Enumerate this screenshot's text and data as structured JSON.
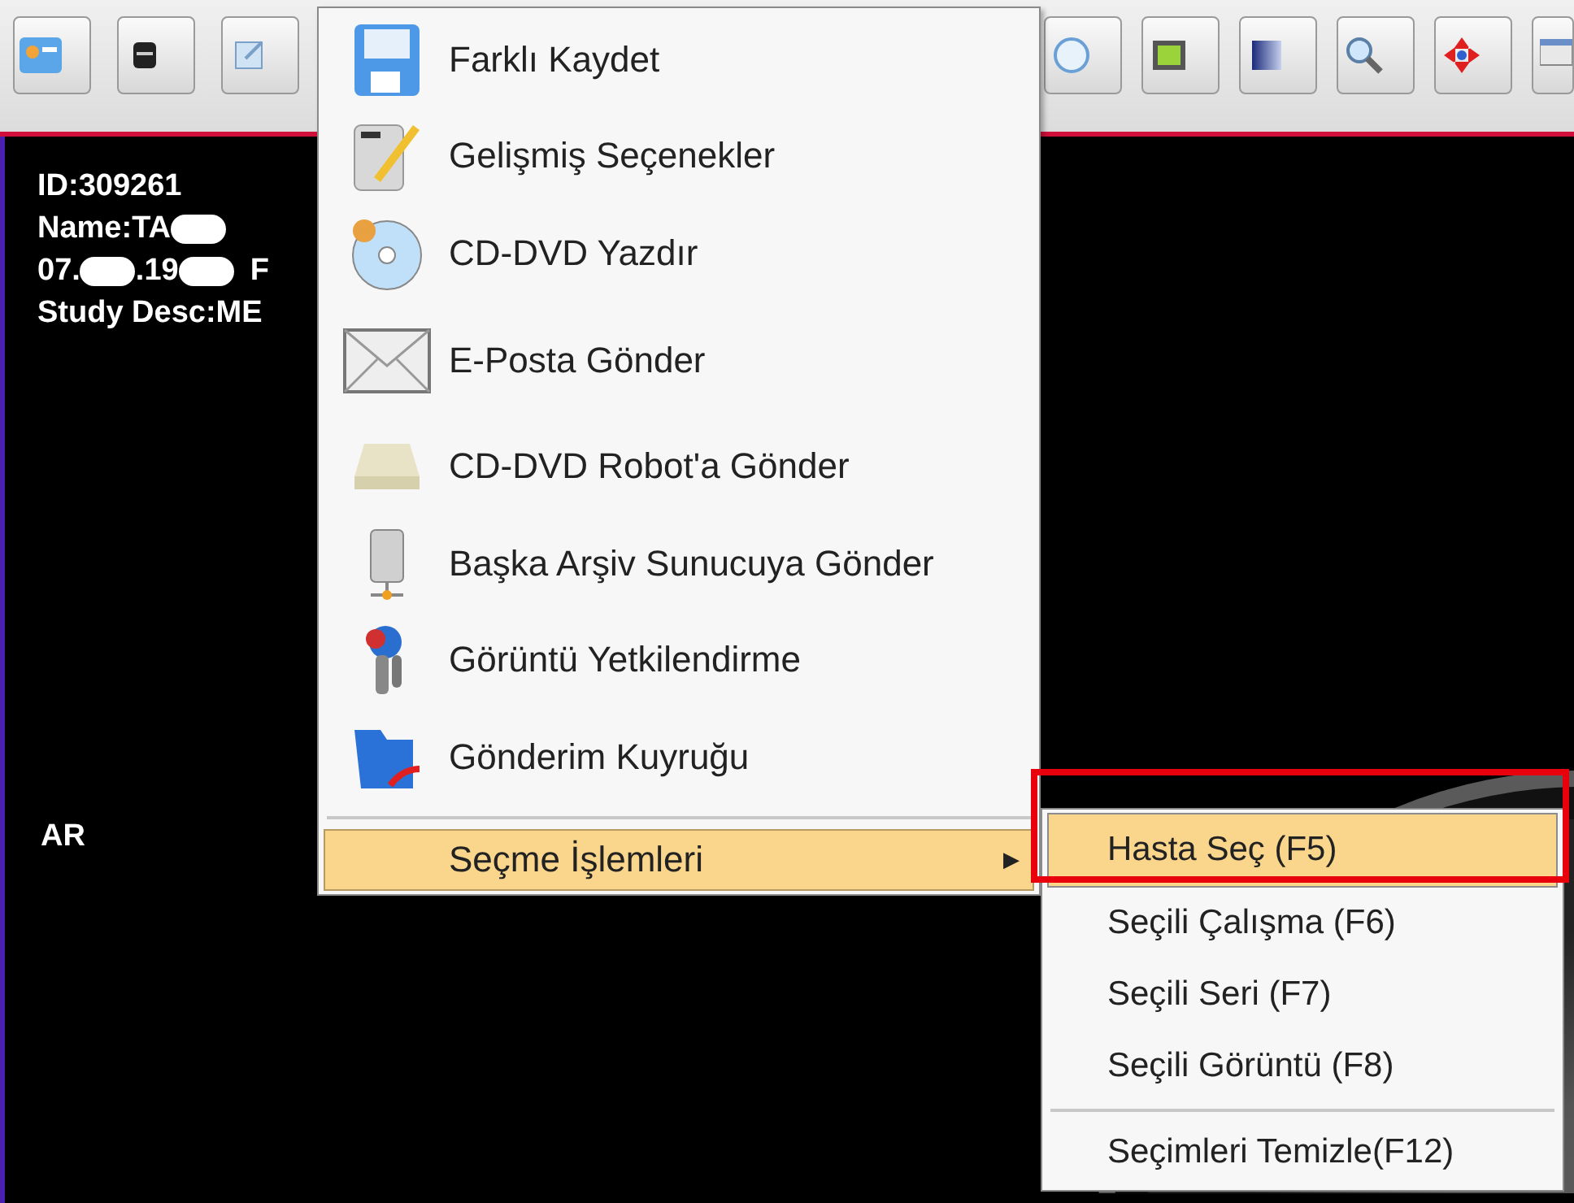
{
  "overlay": {
    "id": "ID:309261",
    "name": "Name:TA",
    "date_parts": [
      "07.",
      ".19"
    ],
    "sex": "F",
    "study": "Study Desc:ME",
    "orientation": "AR"
  },
  "menu": {
    "items": [
      {
        "kind": "floppy",
        "label": "Farklı Kaydet"
      },
      {
        "kind": "pencil",
        "label": "Gelişmiş Seçenekler"
      },
      {
        "kind": "disc",
        "label": "CD-DVD Yazdır"
      },
      {
        "kind": "envelope",
        "label": "E-Posta Gönder"
      },
      {
        "kind": "drive",
        "label": "CD-DVD Robot'a Gönder"
      },
      {
        "kind": "server",
        "label": "Başka Arşiv Sunucuya Gönder"
      },
      {
        "kind": "keys",
        "label": "Görüntü Yetkilendirme"
      },
      {
        "kind": "folder",
        "label": "Gönderim Kuyruğu"
      }
    ],
    "submenu_item": {
      "label": "Seçme İşlemleri",
      "selected": true,
      "arrow": "▶"
    }
  },
  "submenu": {
    "items": [
      {
        "label": "Hasta Seç (F5)",
        "selected": true
      },
      {
        "label": "Seçili Çalışma (F6)",
        "selected": false
      },
      {
        "label": "Seçili Seri (F7)",
        "selected": false
      },
      {
        "label": "Seçili Görüntü (F8)",
        "selected": false
      }
    ],
    "clear_item": {
      "label": "Seçimleri Temizle(F12)",
      "selected": false
    }
  }
}
